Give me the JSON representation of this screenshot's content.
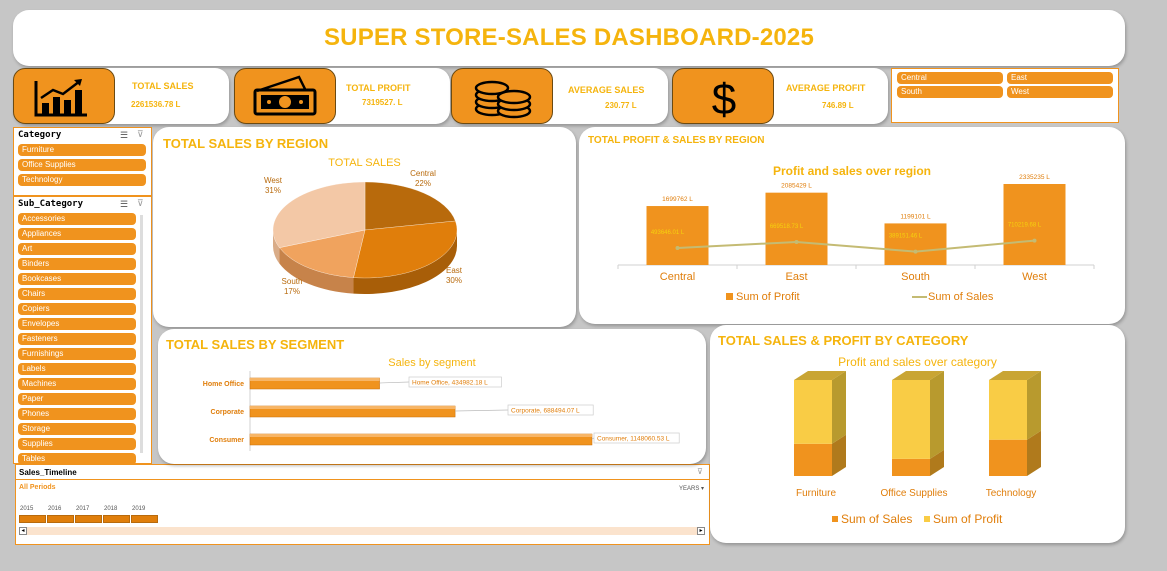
{
  "title": "SUPER STORE-SALES DASHBOARD-2025",
  "kpis": [
    {
      "label": "TOTAL SALES",
      "value": "2261536.78 L",
      "icon": "bar-chart-icon"
    },
    {
      "label": "TOTAL PROFIT",
      "value": "7319527. L",
      "icon": "cash-icon"
    },
    {
      "label": "AVERAGE SALES",
      "value": "230.77 L",
      "icon": "coins-icon"
    },
    {
      "label": "AVERAGE PROFIT",
      "value": "746.89 L",
      "icon": "dollar-icon"
    }
  ],
  "region_slicer": {
    "items": [
      "Central",
      "East",
      "South",
      "West"
    ]
  },
  "category_slicer": {
    "header": "Category",
    "items": [
      "Furniture",
      "Office Supplies",
      "Technology"
    ]
  },
  "subcategory_slicer": {
    "header": "Sub_Category",
    "items": [
      "Accessories",
      "Appliances",
      "Art",
      "Binders",
      "Bookcases",
      "Chairs",
      "Copiers",
      "Envelopes",
      "Fasteners",
      "Furnishings",
      "Labels",
      "Machines",
      "Paper",
      "Phones",
      "Storage",
      "Supplies",
      "Tables"
    ]
  },
  "timeline": {
    "header": "Sales_Timeline",
    "periods_label": "All Periods",
    "unit": "YEARS",
    "years": [
      "2015",
      "2016",
      "2017",
      "2018",
      "2019"
    ]
  },
  "colors": {
    "accent": "#f5b40d",
    "orange": "#f0931e",
    "dark": "#b86a0c",
    "light": "#f5c99f"
  },
  "sections": {
    "region_pie": "TOTAL SALES BY REGION",
    "region_bar": "TOTAL PROFIT & SALES BY REGION",
    "segment": "TOTAL SALES BY SEGMENT",
    "category": "TOTAL SALES & PROFIT BY CATEGORY"
  },
  "chart_data": [
    {
      "type": "pie",
      "title": "TOTAL SALES",
      "slices": [
        {
          "label": "Central",
          "value": 22,
          "pct": "22%"
        },
        {
          "label": "East",
          "value": 30,
          "pct": "30%"
        },
        {
          "label": "South",
          "value": 17,
          "pct": "17%"
        },
        {
          "label": "West",
          "value": 31,
          "pct": "31%"
        }
      ]
    },
    {
      "type": "bar",
      "title": "Profit and sales over region",
      "categories": [
        "Central",
        "East",
        "South",
        "West"
      ],
      "series": [
        {
          "name": "Sum of Profit",
          "values": [
            1699762,
            2085429,
            1199101,
            2335235
          ],
          "labels": [
            "1699762 L",
            "2085429 L",
            "1199101 L",
            "2335235 L"
          ]
        },
        {
          "name": "Sum of Sales",
          "values": [
            493646.01,
            669518.73,
            389151.46,
            710219.68
          ],
          "labels": [
            "493646.01 L",
            "669518.73 L",
            "389151.46 L",
            "710219.68 L"
          ]
        }
      ],
      "ylim": [
        0,
        2500000
      ]
    },
    {
      "type": "bar",
      "title": "Sales by segment",
      "categories": [
        "Home Office",
        "Corporate",
        "Consumer"
      ],
      "values": [
        434982.18,
        688494.07,
        1148060.53
      ],
      "labels": [
        "Home Office, 434982.18 L",
        "Corporate, 688494.07 L",
        "Consumer, 1148060.53 L"
      ],
      "xlim": [
        0,
        1400000
      ]
    },
    {
      "type": "bar",
      "title": "Profit and sales over category",
      "categories": [
        "Furniture",
        "Office Supplies",
        "Technology"
      ],
      "series": [
        {
          "name": "Sum of Sales",
          "values": [
            741999,
            719047,
            836154
          ]
        },
        {
          "name": "Sum of Profit",
          "values": [
            1393000,
            1911000,
            1604000
          ]
        }
      ]
    }
  ]
}
